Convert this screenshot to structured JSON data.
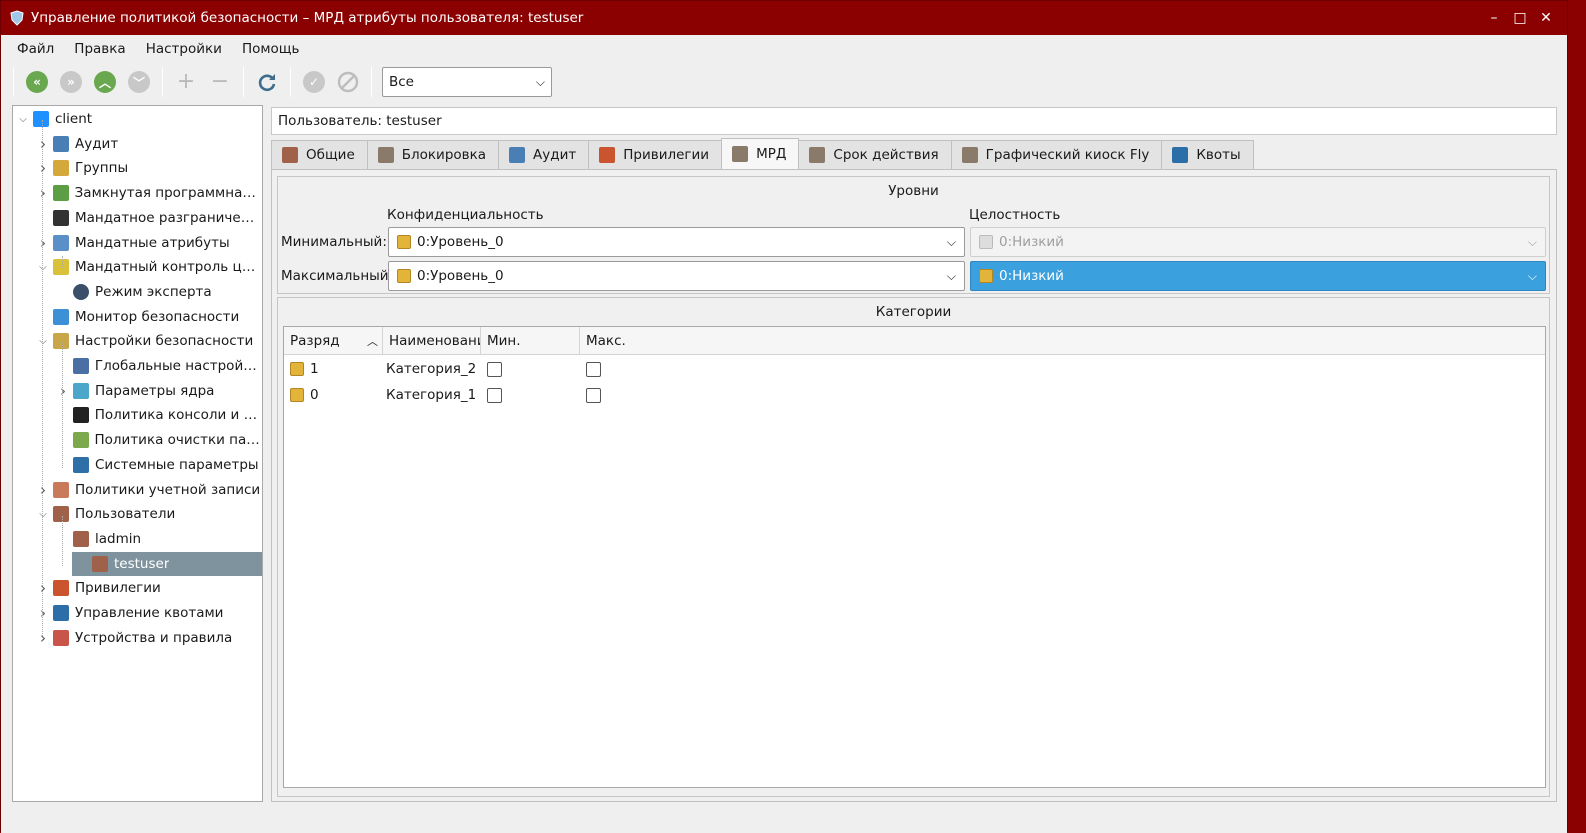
{
  "window": {
    "title": "Управление политикой безопасности – МРД атрибуты пользователя: testuser",
    "controls": [
      "–",
      "□",
      "✕"
    ]
  },
  "menu": [
    "Файл",
    "Правка",
    "Настройки",
    "Помощь"
  ],
  "toolbar": {
    "filter_value": "Все"
  },
  "tree": [
    {
      "label": "client",
      "level": 0,
      "expanded": true,
      "icon": "monitor-icon"
    },
    {
      "label": "Аудит",
      "level": 1,
      "hasChildren": true,
      "icon": "audit-icon"
    },
    {
      "label": "Группы",
      "level": 1,
      "hasChildren": true,
      "icon": "groups-icon"
    },
    {
      "label": "Замкнутая программная ...",
      "level": 1,
      "hasChildren": true,
      "icon": "closed-software-icon"
    },
    {
      "label": "Мандатное разграничен...",
      "level": 1,
      "hasChildren": false,
      "icon": "mandatory-access-icon"
    },
    {
      "label": "Мандатные атрибуты",
      "level": 1,
      "hasChildren": true,
      "icon": "mandatory-attrs-icon"
    },
    {
      "label": "Мандатный контроль це...",
      "level": 1,
      "expanded": true,
      "icon": "integrity-control-icon"
    },
    {
      "label": "Режим эксперта",
      "level": 2,
      "hasChildren": false,
      "icon": "gear-icon"
    },
    {
      "label": "Монитор безопасности",
      "level": 1,
      "hasChildren": false,
      "icon": "lock-icon"
    },
    {
      "label": "Настройки безопасности",
      "level": 1,
      "expanded": true,
      "icon": "tools-icon"
    },
    {
      "label": "Глобальные настройк...",
      "level": 2,
      "hasChildren": false,
      "icon": "global-settings-icon"
    },
    {
      "label": "Параметры ядра",
      "level": 2,
      "hasChildren": true,
      "icon": "kernel-icon"
    },
    {
      "label": "Политика консоли и и...",
      "level": 2,
      "hasChildren": false,
      "icon": "console-icon"
    },
    {
      "label": "Политика очистки пам...",
      "level": 2,
      "hasChildren": false,
      "icon": "memory-clean-icon"
    },
    {
      "label": "Системные параметры",
      "level": 2,
      "hasChildren": false,
      "icon": "system-params-icon"
    },
    {
      "label": "Политики учетной записи",
      "level": 1,
      "hasChildren": true,
      "icon": "account-policy-icon"
    },
    {
      "label": "Пользователи",
      "level": 1,
      "expanded": true,
      "icon": "users-icon"
    },
    {
      "label": "ladmin",
      "level": 2,
      "hasChildren": false,
      "icon": "user-icon"
    },
    {
      "label": "testuser",
      "level": 2,
      "hasChildren": false,
      "icon": "user-icon",
      "selected": true
    },
    {
      "label": "Привилегии",
      "level": 1,
      "hasChildren": true,
      "icon": "privileges-icon"
    },
    {
      "label": "Управление квотами",
      "level": 1,
      "hasChildren": true,
      "icon": "quota-icon"
    },
    {
      "label": "Устройства и правила",
      "level": 1,
      "hasChildren": true,
      "icon": "devices-icon"
    }
  ],
  "user_field": "Пользователь: testuser",
  "tabs": [
    {
      "label": "Общие",
      "icon": "user-icon"
    },
    {
      "label": "Блокировка",
      "icon": "block-icon"
    },
    {
      "label": "Аудит",
      "icon": "audit-icon"
    },
    {
      "label": "Привилегии",
      "icon": "privileges-icon"
    },
    {
      "label": "МРД",
      "icon": "mrd-icon",
      "active": true
    },
    {
      "label": "Срок действия",
      "icon": "expiry-icon"
    },
    {
      "label": "Графический киоск Fly",
      "icon": "kiosk-icon"
    },
    {
      "label": "Квоты",
      "icon": "quota-icon"
    }
  ],
  "levels": {
    "title": "Уровни",
    "conf_header": "Конфиденциальность",
    "integ_header": "Целостность",
    "min_label": "Минимальный:",
    "max_label": "Максимальный:",
    "min_conf": "0:Уровень_0",
    "max_conf": "0:Уровень_0",
    "min_integ": "0:Низкий",
    "max_integ": "0:Низкий"
  },
  "categories": {
    "title": "Категории",
    "columns": [
      "Разряд",
      "Наименовани",
      "Мин.",
      "Макс."
    ],
    "rows": [
      {
        "bit": "1",
        "name": "Категория_2",
        "min": false,
        "max": false
      },
      {
        "bit": "0",
        "name": "Категория_1",
        "min": false,
        "max": false
      }
    ]
  },
  "colors": {
    "titlebar": "#8b0000",
    "selection": "#7f939e",
    "active_combo": "#3aa0de"
  }
}
